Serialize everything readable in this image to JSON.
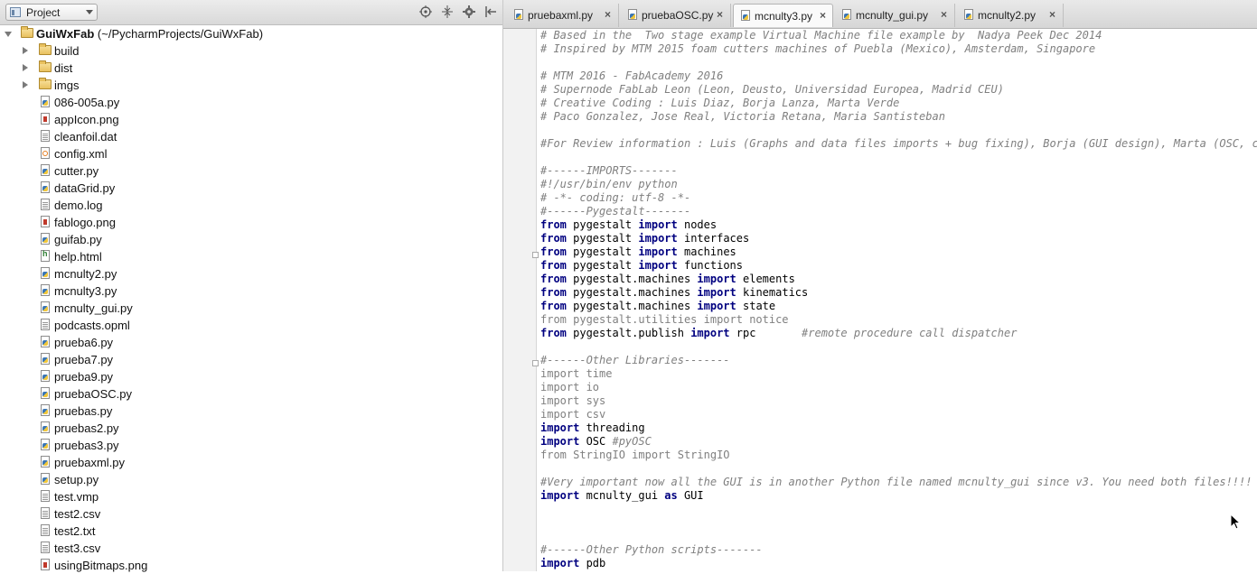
{
  "project_pane": {
    "selector_label": "Project",
    "root": {
      "name": "GuiWxFab",
      "path": "(~/PycharmProjects/GuiWxFab)"
    },
    "folders": [
      "build",
      "dist",
      "imgs"
    ],
    "files": [
      {
        "name": "086-005a.py",
        "type": "py"
      },
      {
        "name": "appIcon.png",
        "type": "png"
      },
      {
        "name": "cleanfoil.dat",
        "type": "txt"
      },
      {
        "name": "config.xml",
        "type": "xml"
      },
      {
        "name": "cutter.py",
        "type": "py"
      },
      {
        "name": "dataGrid.py",
        "type": "py"
      },
      {
        "name": "demo.log",
        "type": "txt"
      },
      {
        "name": "fablogo.png",
        "type": "png"
      },
      {
        "name": "guifab.py",
        "type": "py"
      },
      {
        "name": "help.html",
        "type": "html"
      },
      {
        "name": "mcnulty2.py",
        "type": "py"
      },
      {
        "name": "mcnulty3.py",
        "type": "py"
      },
      {
        "name": "mcnulty_gui.py",
        "type": "py"
      },
      {
        "name": "podcasts.opml",
        "type": "txt"
      },
      {
        "name": "prueba6.py",
        "type": "py"
      },
      {
        "name": "prueba7.py",
        "type": "py"
      },
      {
        "name": "prueba9.py",
        "type": "py"
      },
      {
        "name": "pruebaOSC.py",
        "type": "py"
      },
      {
        "name": "pruebas.py",
        "type": "py"
      },
      {
        "name": "pruebas2.py",
        "type": "py"
      },
      {
        "name": "pruebas3.py",
        "type": "py"
      },
      {
        "name": "pruebaxml.py",
        "type": "py"
      },
      {
        "name": "setup.py",
        "type": "py"
      },
      {
        "name": "test.vmp",
        "type": "txt"
      },
      {
        "name": "test2.csv",
        "type": "txt"
      },
      {
        "name": "test2.txt",
        "type": "txt"
      },
      {
        "name": "test3.csv",
        "type": "txt"
      },
      {
        "name": "usingBitmaps.png",
        "type": "png"
      }
    ]
  },
  "editor": {
    "tabs": [
      {
        "label": "pruebaxml.py",
        "active": false
      },
      {
        "label": "pruebaOSC.py",
        "active": false
      },
      {
        "label": "mcnulty3.py",
        "active": true
      },
      {
        "label": "mcnulty_gui.py",
        "active": false
      },
      {
        "label": "mcnulty2.py",
        "active": false
      }
    ],
    "close_glyph": "×",
    "code_lines": [
      [
        {
          "t": "# Based in the  Two stage example Virtual Machine file example by  Nadya Peek Dec 2014",
          "c": "cm"
        }
      ],
      [
        {
          "t": "# Inspired by MTM 2015 foam cutters machines of Puebla (Mexico), Amsterdam, Singapore",
          "c": "cm"
        }
      ],
      [],
      [
        {
          "t": "# MTM 2016 - FabAcademy 2016",
          "c": "cm"
        }
      ],
      [
        {
          "t": "# Supernode FabLab Leon (Leon, Deusto, Universidad Europea, Madrid CEU)",
          "c": "cm"
        }
      ],
      [
        {
          "t": "# Creative Coding : Luis Diaz, Borja Lanza, Marta Verde",
          "c": "cm"
        }
      ],
      [
        {
          "t": "# Paco Gonzalez, Jose Real, Victoria Retana, Maria Santisteban",
          "c": "cm"
        }
      ],
      [],
      [
        {
          "t": "#For Review information : Luis (Graphs and data files imports + bug fixing), Borja (GUI design), Marta (OSC, code",
          "c": "cm"
        }
      ],
      [],
      [
        {
          "t": "#------IMPORTS-------",
          "c": "cm"
        }
      ],
      [
        {
          "t": "#!/usr/bin/env python",
          "c": "cm"
        }
      ],
      [
        {
          "t": "# -*- coding: utf-8 -*-",
          "c": "cm"
        }
      ],
      [
        {
          "t": "#------Pygestalt-------",
          "c": "cm"
        }
      ],
      [
        {
          "t": "from",
          "c": "kw"
        },
        {
          "t": " pygestalt ",
          "c": ""
        },
        {
          "t": "import",
          "c": "kw"
        },
        {
          "t": " nodes",
          "c": ""
        }
      ],
      [
        {
          "t": "from",
          "c": "kw"
        },
        {
          "t": " pygestalt ",
          "c": ""
        },
        {
          "t": "import",
          "c": "kw"
        },
        {
          "t": " interfaces",
          "c": ""
        }
      ],
      [
        {
          "t": "from",
          "c": "kw"
        },
        {
          "t": " pygestalt ",
          "c": ""
        },
        {
          "t": "import",
          "c": "kw"
        },
        {
          "t": " machines",
          "c": ""
        }
      ],
      [
        {
          "t": "from",
          "c": "kw"
        },
        {
          "t": " pygestalt ",
          "c": ""
        },
        {
          "t": "import",
          "c": "kw"
        },
        {
          "t": " functions",
          "c": ""
        }
      ],
      [
        {
          "t": "from",
          "c": "kw"
        },
        {
          "t": " pygestalt.machines ",
          "c": ""
        },
        {
          "t": "import",
          "c": "kw"
        },
        {
          "t": " elements",
          "c": ""
        }
      ],
      [
        {
          "t": "from",
          "c": "kw"
        },
        {
          "t": " pygestalt.machines ",
          "c": ""
        },
        {
          "t": "import",
          "c": "kw"
        },
        {
          "t": " kinematics",
          "c": ""
        }
      ],
      [
        {
          "t": "from",
          "c": "kw"
        },
        {
          "t": " pygestalt.machines ",
          "c": ""
        },
        {
          "t": "import",
          "c": "kw"
        },
        {
          "t": " state",
          "c": ""
        }
      ],
      [
        {
          "t": "from pygestalt.utilities import notice",
          "c": "dim"
        }
      ],
      [
        {
          "t": "from",
          "c": "kw"
        },
        {
          "t": " pygestalt.publish ",
          "c": ""
        },
        {
          "t": "import",
          "c": "kw"
        },
        {
          "t": " rpc       ",
          "c": ""
        },
        {
          "t": "#remote procedure call dispatcher",
          "c": "cm"
        }
      ],
      [],
      [
        {
          "t": "#------Other Libraries-------",
          "c": "cm"
        }
      ],
      [
        {
          "t": "import time",
          "c": "dim"
        }
      ],
      [
        {
          "t": "import io",
          "c": "dim"
        }
      ],
      [
        {
          "t": "import sys",
          "c": "dim"
        }
      ],
      [
        {
          "t": "import csv",
          "c": "dim"
        }
      ],
      [
        {
          "t": "import",
          "c": "kw"
        },
        {
          "t": " threading",
          "c": ""
        }
      ],
      [
        {
          "t": "import",
          "c": "kw"
        },
        {
          "t": " OSC ",
          "c": ""
        },
        {
          "t": "#pyOSC",
          "c": "cm"
        }
      ],
      [
        {
          "t": "from StringIO import StringIO",
          "c": "dim"
        }
      ],
      [],
      [
        {
          "t": "#Very important now all the GUI is in another Python file named mcnulty_gui since v3. You need both files!!!!",
          "c": "cm"
        }
      ],
      [
        {
          "t": "import",
          "c": "kw"
        },
        {
          "t": " mcnulty_gui ",
          "c": ""
        },
        {
          "t": "as",
          "c": "kw"
        },
        {
          "t": " GUI",
          "c": ""
        }
      ],
      [],
      [],
      [],
      [
        {
          "t": "#------Other Python scripts-------",
          "c": "cm"
        }
      ],
      [
        {
          "t": "import",
          "c": "kw"
        },
        {
          "t": " pdb",
          "c": ""
        }
      ]
    ]
  }
}
